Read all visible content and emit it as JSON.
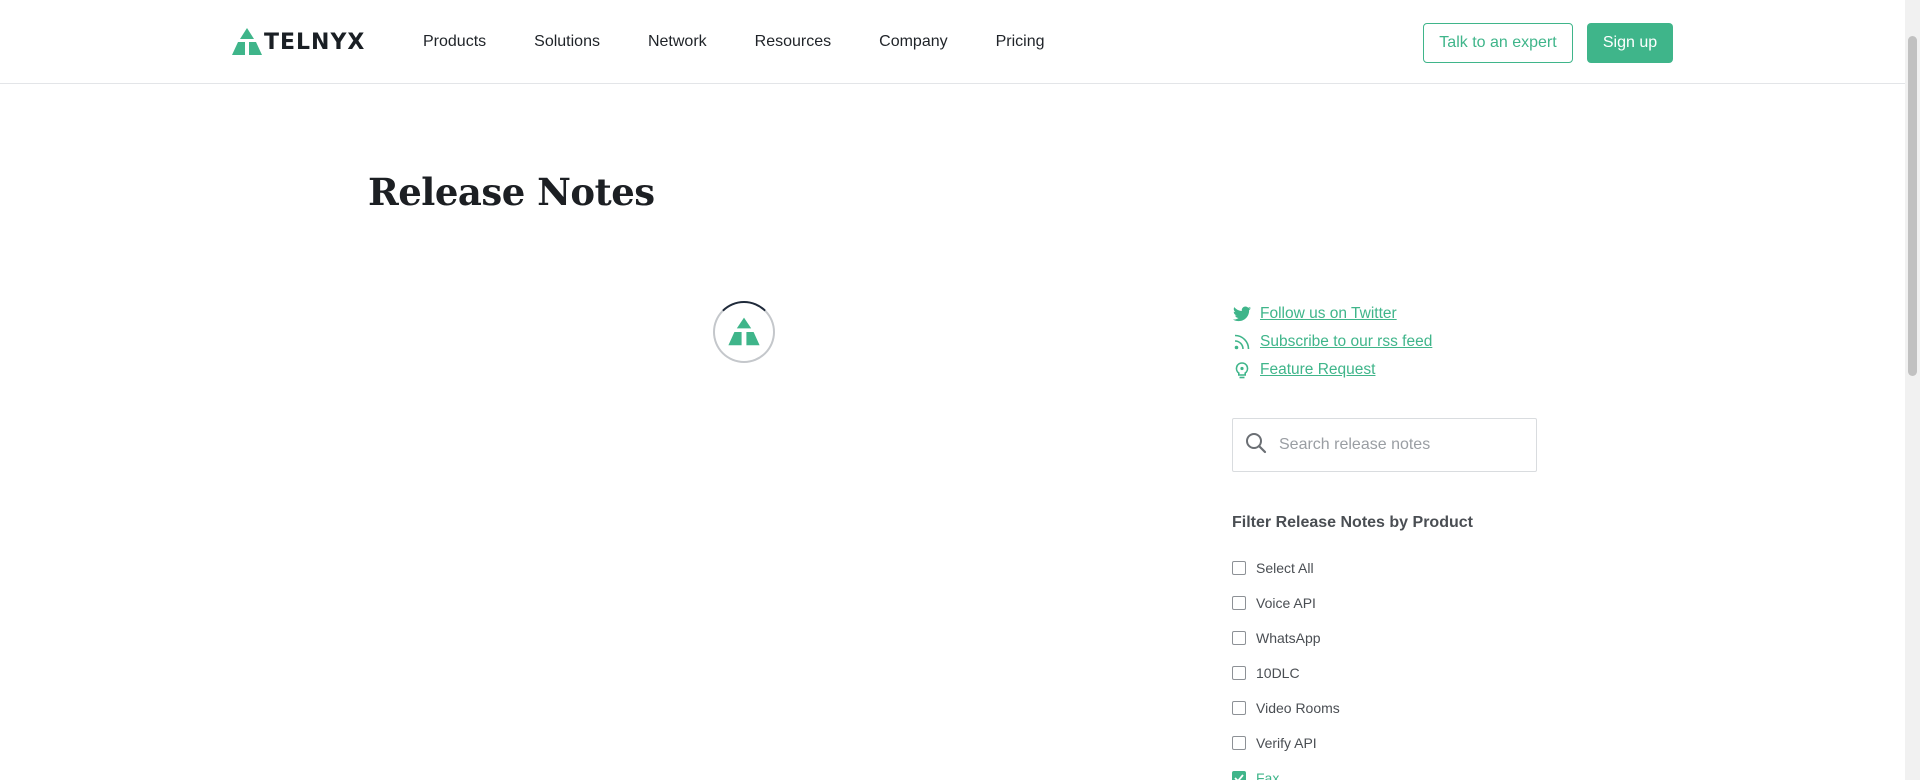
{
  "header": {
    "brand": "TELNYX",
    "nav": [
      "Products",
      "Solutions",
      "Network",
      "Resources",
      "Company",
      "Pricing"
    ],
    "talk_button": "Talk to an expert",
    "signup_button": "Sign up"
  },
  "page": {
    "title": "Release Notes"
  },
  "sidebar": {
    "links": [
      {
        "label": "Follow us on Twitter",
        "icon": "twitter-icon"
      },
      {
        "label": "Subscribe to our rss feed",
        "icon": "rss-icon"
      },
      {
        "label": "Feature Request",
        "icon": "lightbulb-icon"
      }
    ],
    "search_placeholder": "Search release notes",
    "filter_title": "Filter Release Notes by Product",
    "filters": [
      {
        "label": "Select All",
        "checked": false
      },
      {
        "label": "Voice API",
        "checked": false
      },
      {
        "label": "WhatsApp",
        "checked": false
      },
      {
        "label": "10DLC",
        "checked": false
      },
      {
        "label": "Video Rooms",
        "checked": false
      },
      {
        "label": "Verify API",
        "checked": false
      },
      {
        "label": "Fax",
        "checked": true
      }
    ]
  },
  "colors": {
    "accent": "#3fb58a",
    "text": "#1f2328"
  }
}
